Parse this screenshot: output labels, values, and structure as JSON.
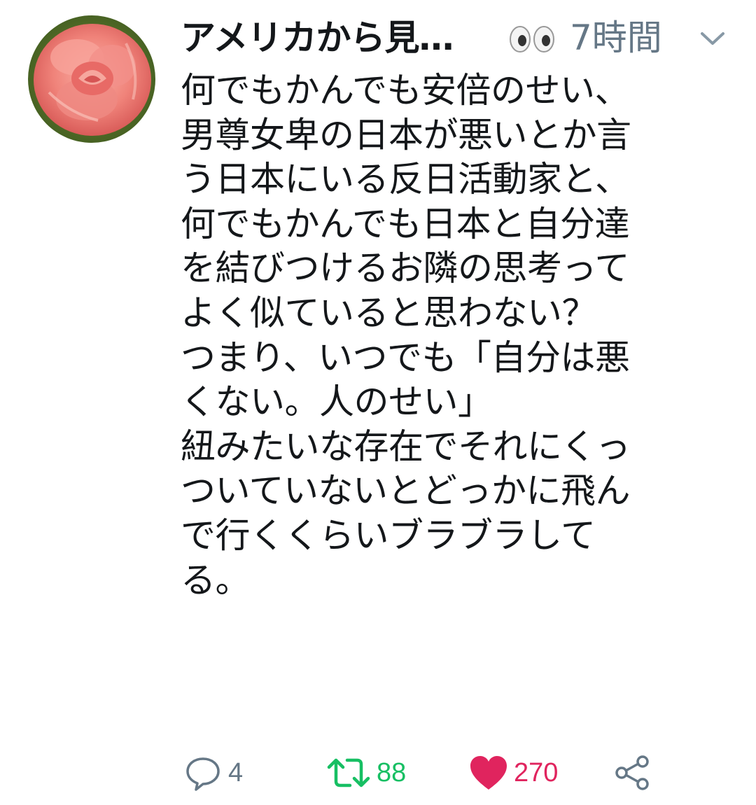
{
  "tweet": {
    "author": {
      "display_name": "アメリカから見…",
      "emoji": "eyes-emoji",
      "avatar": "rose-avatar"
    },
    "timestamp": "7時間",
    "menu_icon": "chevron-down-icon",
    "text_lines": [
      "何でもかんでも安倍のせい、",
      "男尊女卑の日本が悪いとか言",
      "う日本にいる反日活動家と、",
      "何でもかんでも日本と自分達",
      "を結びつけるお隣の思考って",
      "よく似ていると思わない？",
      "つまり、いつでも「自分は悪",
      "くない。人のせい」",
      "紐みたいな存在でそれにくっ",
      "ついていないとどっかに飛ん",
      "で行くくらいブラブラして",
      "る。"
    ],
    "actions": {
      "reply": {
        "icon": "reply-icon",
        "count": "4",
        "color": "#657786"
      },
      "retweet": {
        "icon": "retweet-icon",
        "count": "88",
        "color": "#17bf63"
      },
      "like": {
        "icon": "heart-icon",
        "count": "270",
        "color": "#e0245e"
      },
      "share": {
        "icon": "share-icon",
        "color": "#657786"
      }
    }
  }
}
